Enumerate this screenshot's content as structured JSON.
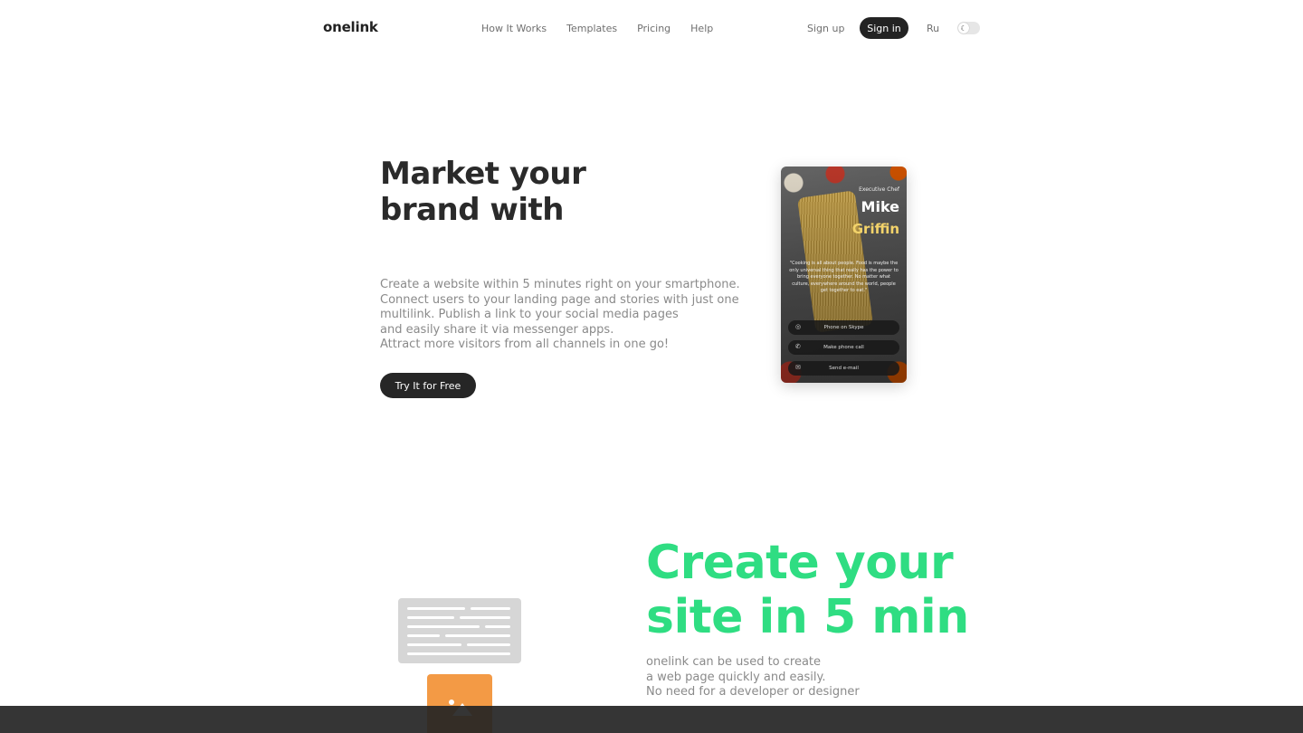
{
  "header": {
    "logo": "onelink",
    "nav": [
      "How It Works",
      "Templates",
      "Pricing",
      "Help"
    ],
    "signup": "Sign up",
    "signin": "Sign in",
    "lang": "Ru",
    "theme_icon": "moon-icon"
  },
  "hero": {
    "title_line1": "Market your",
    "title_line2": "brand with",
    "desc": [
      "Create a website within 5 minutes right on your smartphone.",
      "Connect users to your landing page and stories with just one",
      "multilink. Publish a link to your social media pages",
      "and easily share it via messenger apps.",
      "Attract more visitors from all channels in one go!"
    ],
    "cta": "Try It for Free"
  },
  "phone": {
    "role": "Executive Chef",
    "first_name": "Mike",
    "last_name": "Griffin",
    "quote": "\"Cooking is all about people. Food is maybe the only universal thing that really has the power to bring everyone together. No matter what culture, everywhere around the world, people get together to eat.\"",
    "buttons": [
      {
        "label": "Phone on Skype",
        "icon": "skype-icon"
      },
      {
        "label": "Make phone call",
        "icon": "phone-icon"
      },
      {
        "label": "Send e-mail",
        "icon": "mail-icon"
      }
    ]
  },
  "section2": {
    "title_line1": "Create your",
    "title_line2": "site in 5 min",
    "desc": [
      "onelink can be used to create",
      "a web page quickly and easily.",
      "No need for a developer or designer"
    ],
    "accent": "#2fdd82",
    "image_placeholder_color": "#f39a45"
  }
}
